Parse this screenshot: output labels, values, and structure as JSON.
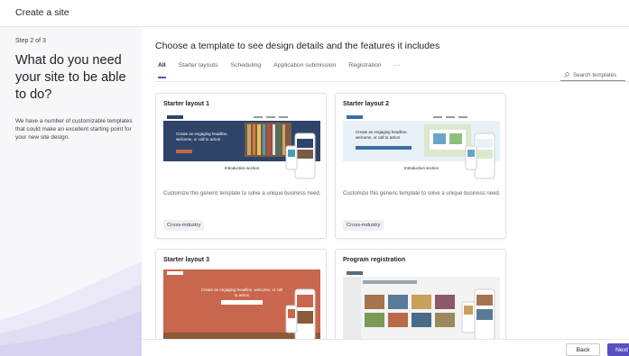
{
  "header": {
    "title": "Create a site"
  },
  "left": {
    "step": "Step 2 of 3",
    "headline": "What do you need your site to be able to do?",
    "description": "We have a number of customizable templates that could make an excellent starting point for your new site design."
  },
  "main": {
    "heading": "Choose a template to see design details and the features it includes",
    "tabs": [
      {
        "label": "All",
        "active": true
      },
      {
        "label": "Starter layouts",
        "active": false
      },
      {
        "label": "Scheduling",
        "active": false
      },
      {
        "label": "Application submission",
        "active": false
      },
      {
        "label": "Registration",
        "active": false
      },
      {
        "label": "···",
        "active": false
      }
    ],
    "search": {
      "placeholder": "Search templates",
      "icon": "search-icon"
    }
  },
  "cards": [
    {
      "title": "Starter layout 1",
      "description": "Customize this generic template to solve a unique business need.",
      "tag": "Cross-industry",
      "preview_hero_text": "Create an engaging headline, welcome, or call to action",
      "preview_section_text": "Introduction section"
    },
    {
      "title": "Starter layout 2",
      "description": "Customize this generic template to solve a unique business need.",
      "tag": "Cross-industry",
      "preview_hero_text": "Create an engaging headline, welcome, or call to action",
      "preview_section_text": "Introduction section"
    },
    {
      "title": "Starter layout 3",
      "preview_hero_text": "Create an engaging headline, welcome, or call to action"
    },
    {
      "title": "Program registration"
    }
  ],
  "footer": {
    "back_label": "Back",
    "next_label": "Next"
  },
  "colors": {
    "accent": "#5b4fc2",
    "layout1_hero": "#2e4468",
    "layout3_hero": "#c8674d",
    "pane_bg": "#f7f6fb"
  }
}
